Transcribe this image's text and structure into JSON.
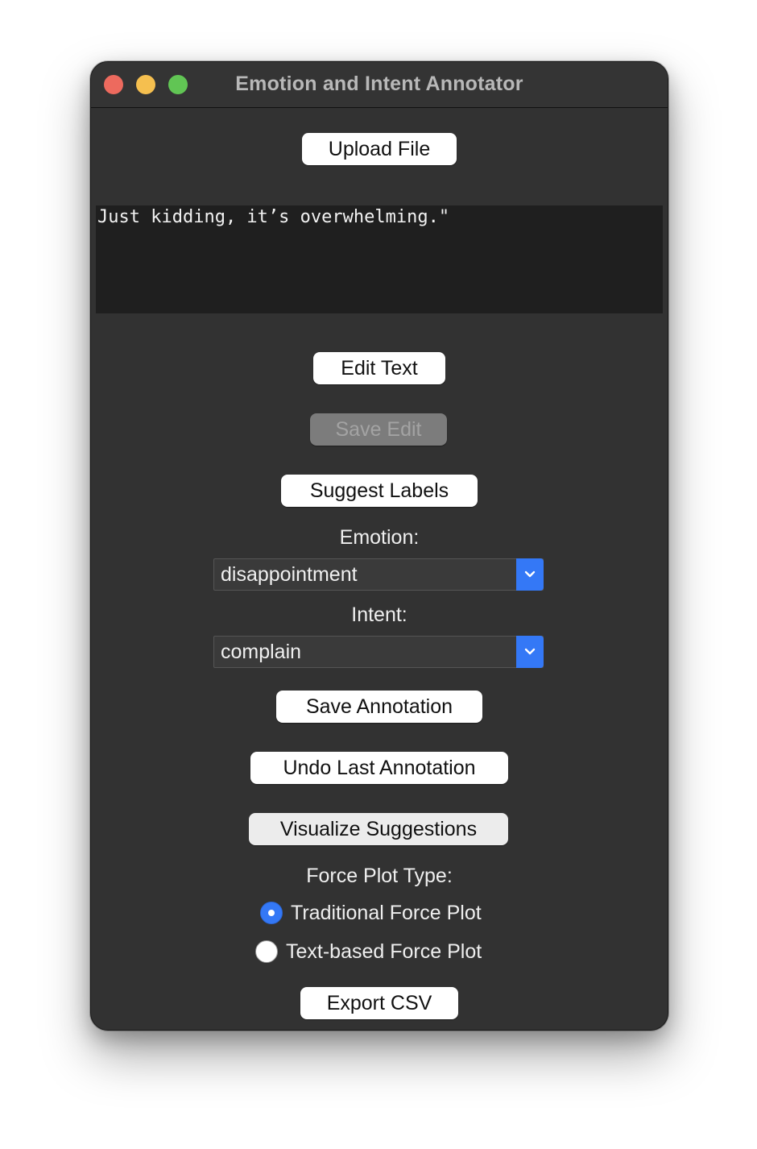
{
  "window": {
    "title": "Emotion and Intent Annotator"
  },
  "buttons": {
    "upload": "Upload File",
    "edit_text": "Edit Text",
    "save_edit": "Save Edit",
    "suggest_labels": "Suggest Labels",
    "save_annotation": "Save Annotation",
    "undo_last": "Undo Last Annotation",
    "visualize": "Visualize Suggestions",
    "export_csv": "Export CSV"
  },
  "text_area": {
    "content": "Just kidding, it’s overwhelming.\""
  },
  "emotion": {
    "label": "Emotion:",
    "selected": "disappointment"
  },
  "intent": {
    "label": "Intent:",
    "selected": "complain"
  },
  "force_plot": {
    "label": "Force Plot Type:",
    "options": [
      {
        "label": "Traditional Force Plot",
        "selected": true
      },
      {
        "label": "Text-based Force Plot",
        "selected": false
      }
    ]
  },
  "colors": {
    "window_bg": "#323232",
    "accent": "#3478f6",
    "close": "#ed6a5e",
    "minimize": "#f5bf4f",
    "maximize": "#61c554"
  }
}
